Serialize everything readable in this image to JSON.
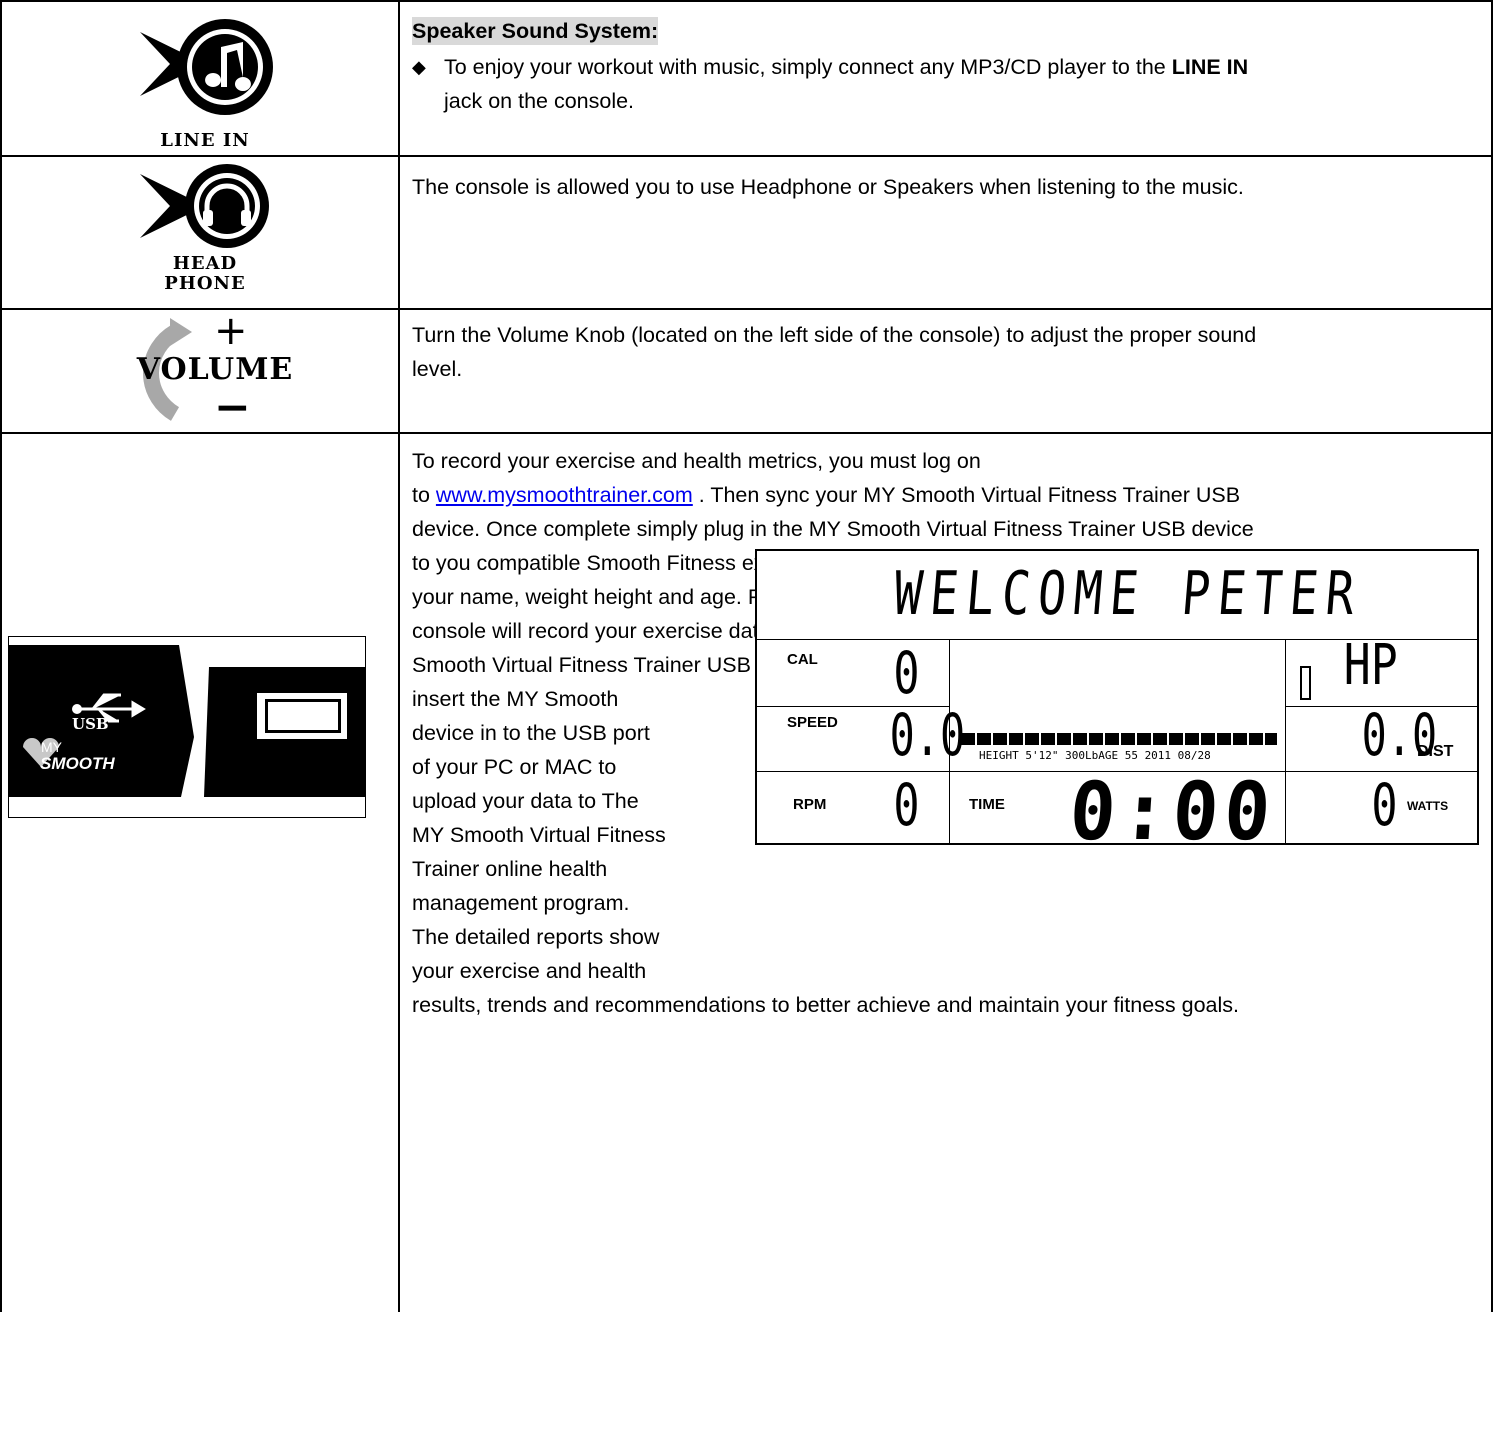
{
  "rows": {
    "line_in": {
      "icon_label": "LINE IN",
      "heading": "Speaker Sound System:",
      "bullet_text_1": "To enjoy your workout with music, simply connect any MP3/CD player to the ",
      "bullet_bold": "LINE IN",
      "bullet_text_2": "jack on the console."
    },
    "headphone": {
      "icon_label_1": "HEAD",
      "icon_label_2": "PHONE",
      "text": "The console is allowed you to use Headphone or Speakers when listening to the music."
    },
    "volume": {
      "icon_label": "VOLUME",
      "plus": "+",
      "minus": "−",
      "text_1": "Turn the Volume Knob (located on the left side of the console) to adjust the proper sound",
      "text_2": "level."
    },
    "usb": {
      "icon_usb": "USB",
      "icon_my": "MY",
      "icon_smooth": "SMOOTH",
      "line_1": "To record your exercise and health metrics, you must log on",
      "line_2_pre": "to ",
      "link": "www.mysmoothtrainer.com",
      "line_2_post": " . Then sync your MY Smooth Virtual Fitness Trainer USB",
      "line_3": "device. Once complete simply plug in the MY Smooth Virtual Fitness Trainer USB device",
      "line_4": "to you compatible Smooth Fitness exercise machine. Displayed on the equipment will be",
      "line_5": "your name, weight height and age. Press “START” button to begin your workout, the",
      "line_6": "console will record your exercise data automatically, every 20 seconds, to your MY",
      "line_7": "Smooth Virtual Fitness Trainer USB device. After your exercise session is complete,",
      "narrow_lines": [
        "insert the MY Smooth",
        "device in to the USB port",
        "of your PC or MAC to",
        "upload your data to The",
        "MY Smooth Virtual Fitness",
        "Trainer online health",
        "management program.",
        "The detailed reports show",
        "your exercise and health"
      ],
      "last_line": "results, trends and recommendations to better achieve and maintain your fitness goals."
    }
  },
  "lcd": {
    "banner": "WELCOME PETER",
    "cal_label": "CAL",
    "cal_value": "0",
    "hp_value": "HP",
    "speed_label": "SPEED",
    "speed_value": "0.0",
    "dist_value": "0.0",
    "dist_label": "DIST",
    "info_line": "HEIGHT 5'12\"   300LbAGE 55 2011 08/28",
    "rpm_label": "RPM",
    "rpm_value": "0",
    "time_label": "TIME",
    "time_value": "0:00",
    "watts_value": "0",
    "watts_label": "WATTS"
  }
}
